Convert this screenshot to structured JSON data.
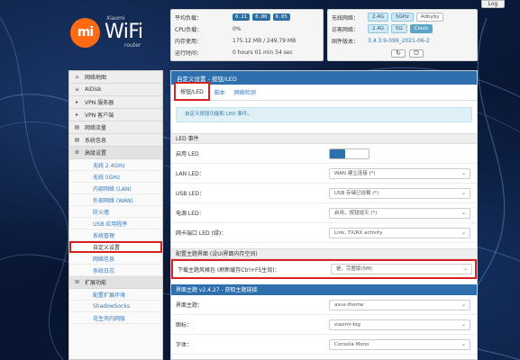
{
  "header": {
    "login_label": "Log"
  },
  "logo": {
    "mark": "mi",
    "small": "Xiaomi",
    "wifi": "WiFi",
    "router": "router"
  },
  "status_left": {
    "rows": [
      {
        "label": "平均负载：",
        "badges": [
          "0.21",
          "0.06",
          "0.05"
        ]
      },
      {
        "label": "CPU负载：",
        "value": "0%"
      },
      {
        "label": "内存使用：",
        "value": "175.12 MB / 249.79 MB"
      },
      {
        "label": "运行时间：",
        "value": "0 hours 01 min 54 sec"
      }
    ]
  },
  "status_right": {
    "wireless_label": "无线网络：",
    "wireless_tags": [
      "2.4G",
      "5GHz"
    ],
    "wireless_name": "Adbyby",
    "visitor_label": "访客网络：",
    "visitor_tags": [
      "2.4G",
      "5G"
    ],
    "visitor_extra": "Clash",
    "firmware_label": "固件版本：",
    "firmware_value": "3.4.3.9-099_2021-06-2",
    "refresh_icon": "refresh-icon",
    "power_icon": "power-icon"
  },
  "sidebar": {
    "items": [
      {
        "icon": "home-icon",
        "glyph": "⌂",
        "label": "网络地图"
      },
      {
        "icon": "list-icon",
        "glyph": "≡",
        "label": "AiDisk"
      },
      {
        "icon": "vpn-icon",
        "glyph": "▸",
        "label": "VPN 服务器"
      },
      {
        "icon": "vpn-client-icon",
        "glyph": "▸",
        "label": "VPN 客户端"
      },
      {
        "icon": "traffic-icon",
        "glyph": "▤",
        "label": "网络流量"
      },
      {
        "icon": "log-icon",
        "glyph": "▤",
        "label": "系统信息"
      },
      {
        "icon": "settings-icon",
        "glyph": "⚙",
        "label": "高级设置"
      }
    ],
    "subitems": [
      "无线 2.4GHz",
      "无线 5GHz",
      "内部网络 (LAN)",
      "外部网络 (WAN)",
      "防火墙",
      "USB 应用程序",
      "系统管理",
      "自定义设置",
      "网络信息",
      "系统日志"
    ],
    "extra_item": {
      "icon": "extensions-icon",
      "glyph": "⊞",
      "label": "扩展功能"
    },
    "extra_subitems": [
      "配置扩展环境",
      "ShadowSocks",
      "花生壳内网版"
    ]
  },
  "main": {
    "title": "自定义设置 - 按钮/LED",
    "tabs": [
      "按钮/LED",
      "脚本",
      "网络检测"
    ],
    "info": "自定义按钮功能和 LED 事件。",
    "section_led": "LED 事件",
    "led_enable_label": "启用 LED",
    "rows": [
      {
        "label": "LAN LED：",
        "value": "WAN 建立连接 (*)"
      },
      {
        "label": "USB LED：",
        "value": "USB 存储已挂载 (*)"
      },
      {
        "label": "电源 LED：",
        "value": "启用，按钮熄灭 (*)"
      },
      {
        "label": "网卡端口 LED (绿)：",
        "value": "Link, TX/RX activity"
      }
    ],
    "section_theme": "配置主题界面 (设UI界面内存空间)",
    "theme_row": {
      "label": "下载主题风格包 (刷新缓存Ctrl+F5生效)：",
      "value": "是，完整版(5M)"
    },
    "section_theme_ver": "界面主题 v2.4.27 - 获取主题链接",
    "theme_rows": [
      {
        "label": "界面主题：",
        "value": "asus-theme"
      },
      {
        "label": "图标：",
        "value": "xiaomi-big"
      },
      {
        "label": "字体：",
        "value": "Consola Mono"
      }
    ]
  }
}
